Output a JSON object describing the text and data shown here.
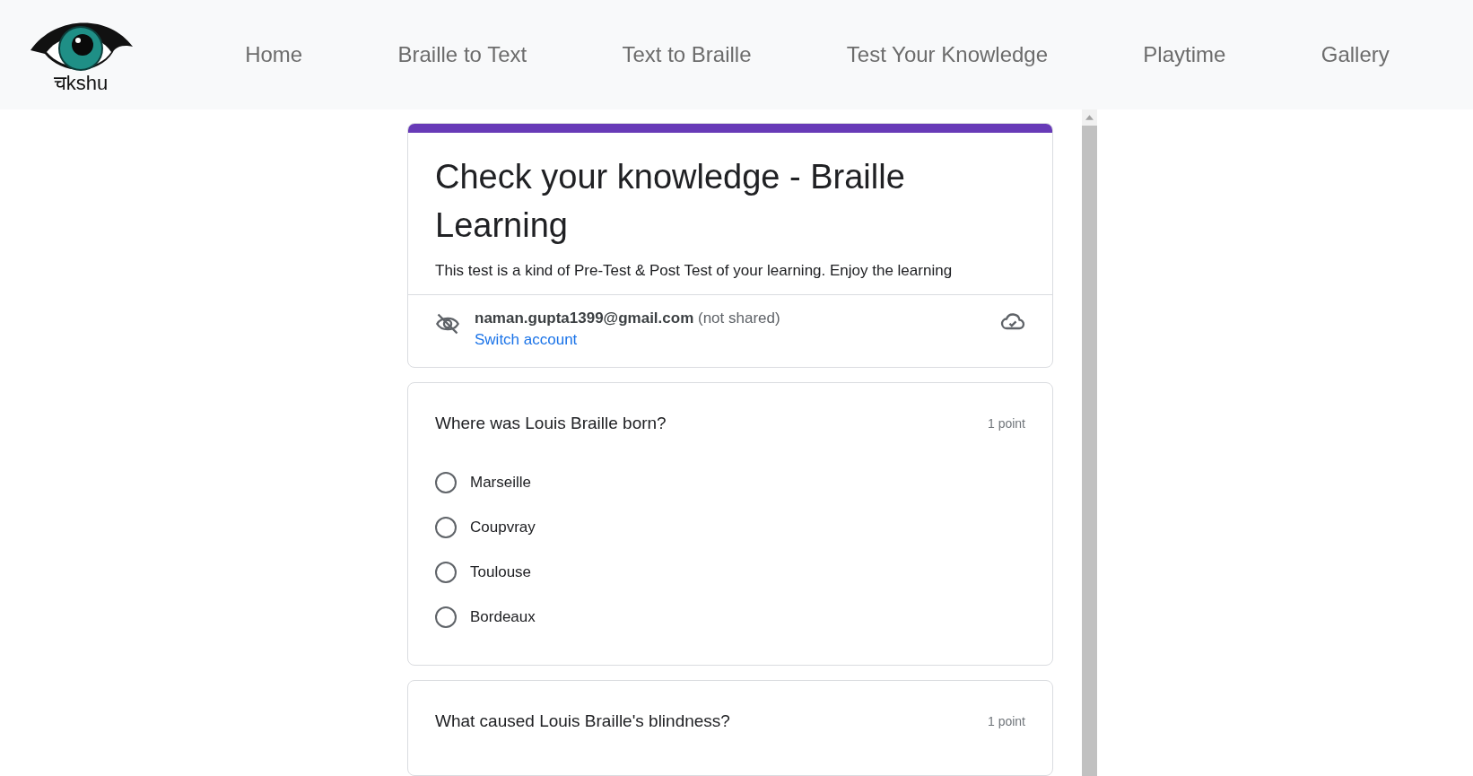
{
  "logo": {
    "text": "चkshu"
  },
  "nav": [
    {
      "label": "Home"
    },
    {
      "label": "Braille to Text"
    },
    {
      "label": "Text to Braille"
    },
    {
      "label": "Test Your Knowledge"
    },
    {
      "label": "Playtime"
    },
    {
      "label": "Gallery"
    }
  ],
  "form": {
    "title": "Check your knowledge - Braille Learning",
    "description": "This test is a kind of Pre-Test & Post Test of your learning. Enjoy the learning",
    "account": {
      "email": "naman.gupta1399@gmail.com",
      "note": "(not shared)",
      "switch_link": "Switch account"
    },
    "questions": [
      {
        "text": "Where was Louis Braille born?",
        "points": "1 point",
        "options": [
          {
            "label": "Marseille",
            "selected": false
          },
          {
            "label": "Coupvray",
            "selected": false
          },
          {
            "label": "Toulouse",
            "selected": false
          },
          {
            "label": "Bordeaux",
            "selected": false
          }
        ]
      },
      {
        "text": "What caused Louis Braille's blindness?",
        "points": "1 point"
      }
    ]
  }
}
